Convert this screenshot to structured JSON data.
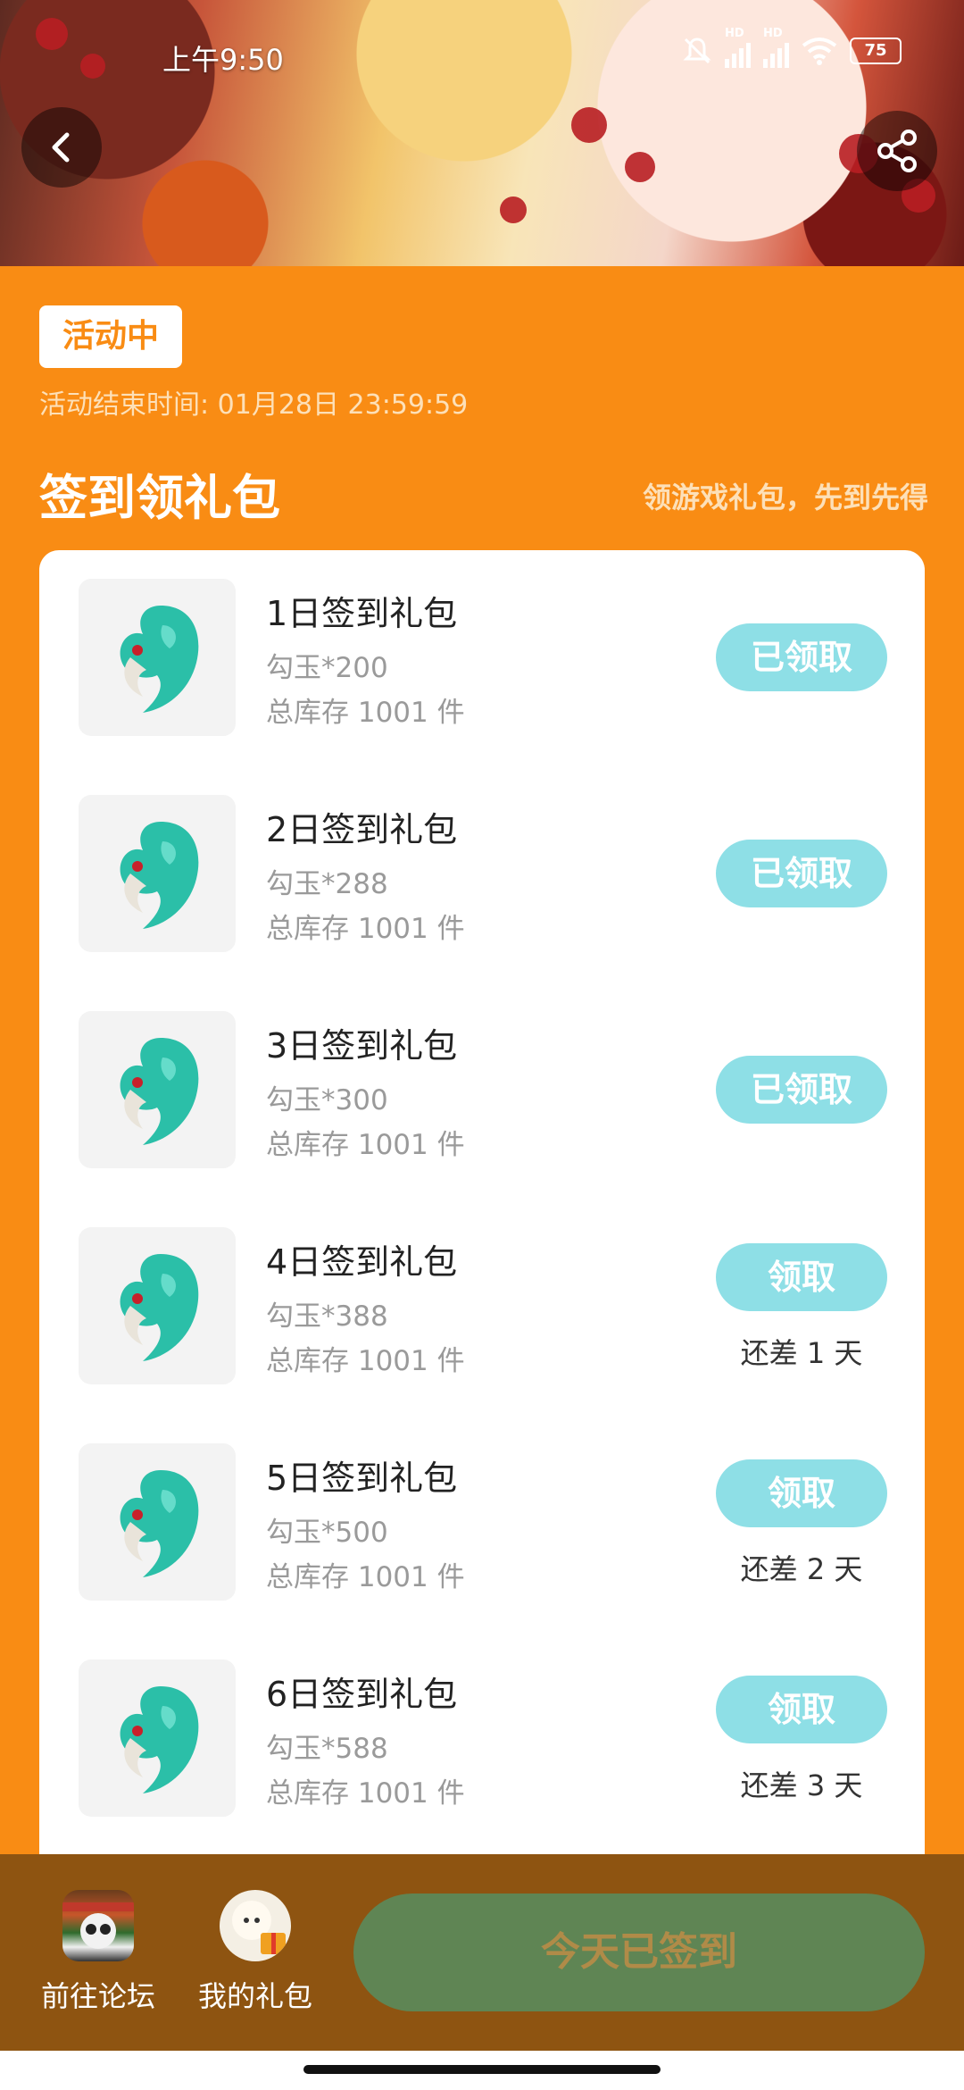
{
  "status_bar": {
    "time": "上午9:50",
    "battery": "75",
    "hd1": "HD",
    "hd2": "HD"
  },
  "header": {
    "badge": "活动中",
    "end_time": "活动结束时间: 01月28日 23:59:59",
    "section_title": "签到领礼包",
    "section_subtitle": "领游戏礼包，先到先得"
  },
  "gifts": [
    {
      "name": "1日签到礼包",
      "reward": "勾玉*200",
      "stock": "总库存 1001 件",
      "button": "已领取",
      "remaining": ""
    },
    {
      "name": "2日签到礼包",
      "reward": "勾玉*288",
      "stock": "总库存 1001 件",
      "button": "已领取",
      "remaining": ""
    },
    {
      "name": "3日签到礼包",
      "reward": "勾玉*300",
      "stock": "总库存 1001 件",
      "button": "已领取",
      "remaining": ""
    },
    {
      "name": "4日签到礼包",
      "reward": "勾玉*388",
      "stock": "总库存 1001 件",
      "button": "领取",
      "remaining": "还差 1 天"
    },
    {
      "name": "5日签到礼包",
      "reward": "勾玉*500",
      "stock": "总库存 1001 件",
      "button": "领取",
      "remaining": "还差 2 天"
    },
    {
      "name": "6日签到礼包",
      "reward": "勾玉*588",
      "stock": "总库存 1001 件",
      "button": "领取",
      "remaining": "还差 3 天"
    }
  ],
  "bottom_bar": {
    "forum_label": "前往论坛",
    "my_gifts_label": "我的礼包",
    "signed_button": "今天已签到"
  },
  "colors": {
    "accent": "#F98C14",
    "button": "#8EDFE6",
    "bottom": "#8E5411",
    "signed": "#5F8554"
  }
}
